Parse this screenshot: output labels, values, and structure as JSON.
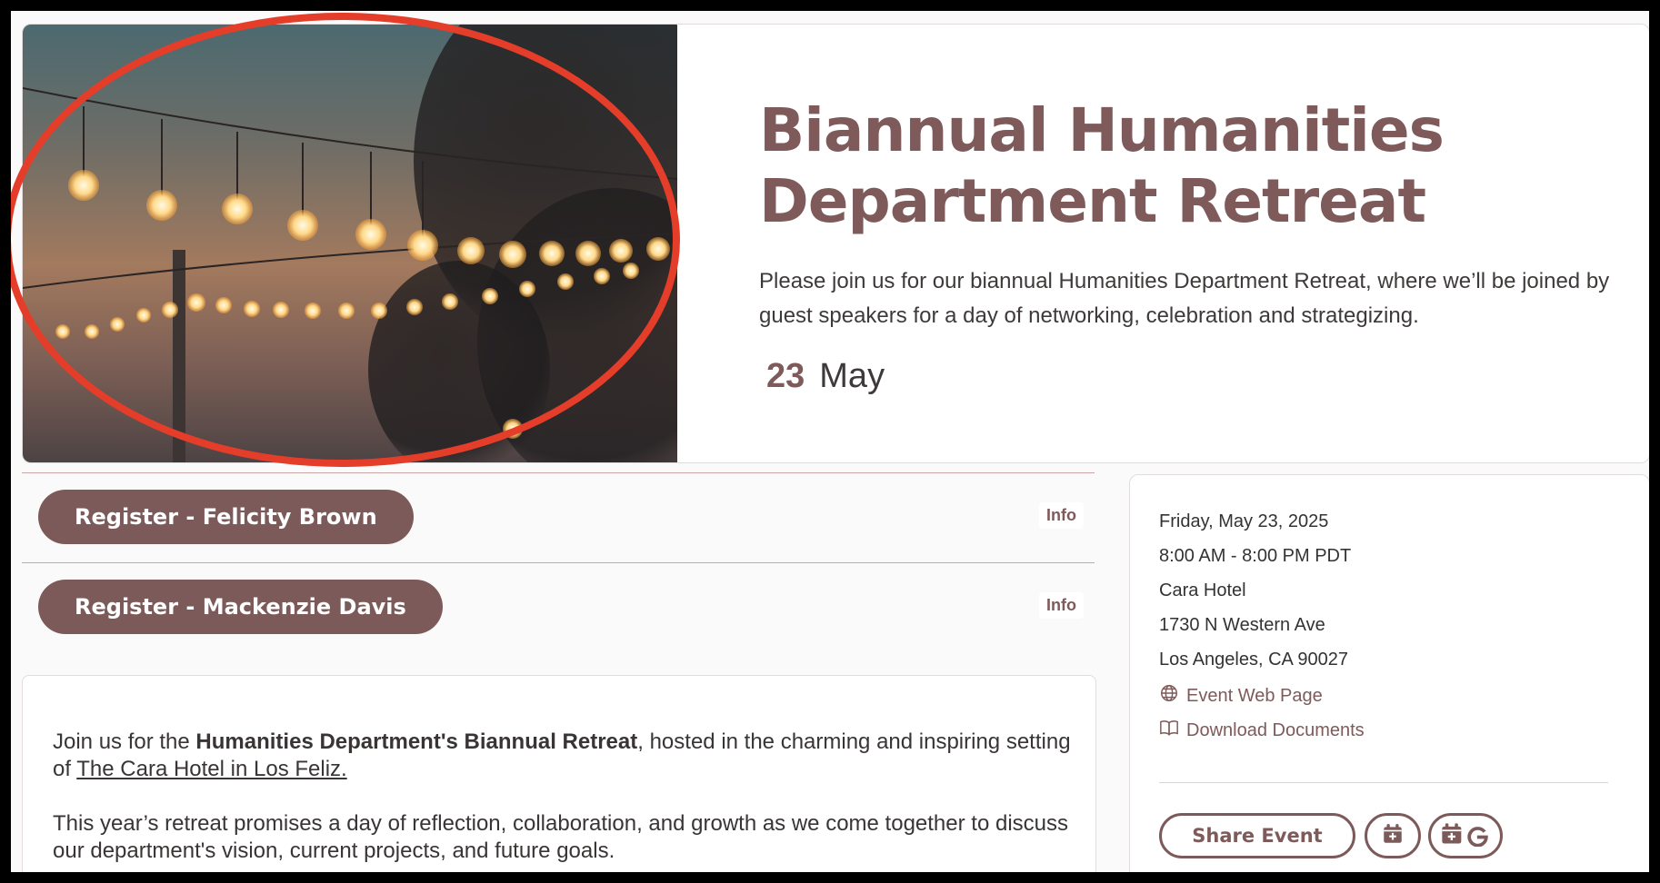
{
  "event": {
    "title_line1": "Biannual Humanities",
    "title_line2": "Department Retreat",
    "description": "Please join us for our biannual Humanities Department Retreat, where we’ll be joined by guest speakers for a day of networking, celebration and strategizing.",
    "date_day": "23",
    "date_month": "May"
  },
  "registrations": [
    {
      "label": "Register - Felicity Brown",
      "info": "Info"
    },
    {
      "label": "Register - Mackenzie Davis",
      "info": "Info"
    }
  ],
  "details": {
    "p1_before": "Join us for the ",
    "p1_bold": "Humanities Department's Biannual Retreat",
    "p1_after": ", hosted in the charming and inspiring setting of ",
    "p1_link": "The Cara Hotel in Los Feliz.",
    "p2": "This year’s retreat promises a day of reflection, collaboration, and growth as we come together to discuss our department's vision, current projects, and future goals."
  },
  "sidebar": {
    "date": "Friday, May 23, 2025",
    "time": "8:00 AM - 8:00 PM PDT",
    "venue": "Cara Hotel",
    "address1": "1730 N Western Ave",
    "address2": "Los Angeles, CA 90027",
    "web_link": "Event Web Page",
    "docs_link": "Download Documents",
    "share_label": "Share Event"
  },
  "icons": {
    "web": "globe-icon",
    "docs": "book-icon",
    "calendar": "calendar-add-icon",
    "google_calendar": "google-calendar-icon"
  },
  "colors": {
    "brand": "#7d5a5a",
    "annotation": "#e43d2a"
  }
}
